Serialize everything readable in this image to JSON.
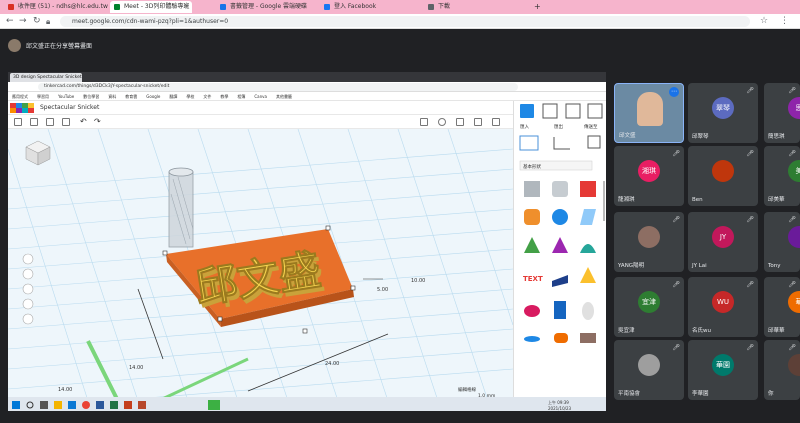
{
  "browser": {
    "tabs": [
      {
        "label": "收件匣 (51) - ndhs@hlc.edu.tw",
        "color": "#d93025",
        "active": false
      },
      {
        "label": "Meet - 3D列印體驗專班",
        "color": "#00832d",
        "active": true
      },
      {
        "label": "書籤管理 - Google 雲端硬碟",
        "color": "#1a73e8",
        "active": false
      },
      {
        "label": "登入 Facebook",
        "color": "#1877f2",
        "active": false
      },
      {
        "label": "下載",
        "color": "#5f6368",
        "active": false
      }
    ],
    "new_tab": "+",
    "url": "meet.google.com/cdn-wami-pzq?pli=1&authuser=0"
  },
  "meet": {
    "presenter_text": "邱文盛正在分享螢幕畫面"
  },
  "shared": {
    "inner_tab_title": "3D design Spectacular Snicket",
    "inner_url": "tinkercad.com/things/d3DCk3jY-spectacular-snicket/edit",
    "bookmarks": [
      "應用程式",
      "學習用",
      "YouTube",
      "數位學習",
      "資料",
      "教育雲",
      "Google",
      "翻譯",
      "學校",
      "文件",
      "教學",
      "相簿",
      "Canva",
      "其他書籤"
    ],
    "design_title": "Spectacular Snicket",
    "model_text": "邱文盛",
    "dims": {
      "w": "24.00",
      "d": "14.00",
      "h": "10.00",
      "h2": "5.00"
    },
    "panel": {
      "tabs": [
        "匯入",
        "匯出",
        "傳送至"
      ],
      "category": "基本形狀"
    },
    "view_label": "編輯格線",
    "snap_label": "貼齊格線",
    "snap_value": "1.0 mm",
    "clock": "上午 09:39",
    "date": "2021/10/23"
  },
  "participants": [
    {
      "name": "邱文盛",
      "initial": "",
      "color": "#6b8aa3",
      "muted": false,
      "camera": true
    },
    {
      "name": "邱翠琴",
      "initial": "翠琴",
      "color": "#5c6bc0",
      "muted": true
    },
    {
      "name": "簡思琪",
      "initial": "思",
      "color": "#8e24aa",
      "muted": true
    },
    {
      "name": "龍湘琪",
      "initial": "湘琪",
      "color": "#e91e63",
      "muted": true
    },
    {
      "name": "Ben",
      "initial": "",
      "color": "#bf360c",
      "muted": true
    },
    {
      "name": "邱美華",
      "initial": "美",
      "color": "#2e7d32",
      "muted": true
    },
    {
      "name": "YANG陽明",
      "initial": "",
      "color": "#8d6e63",
      "muted": true
    },
    {
      "name": "JY Lai",
      "initial": "JY",
      "color": "#c2185b",
      "muted": true
    },
    {
      "name": "Tony",
      "initial": "",
      "color": "#6a1b9a",
      "muted": true
    },
    {
      "name": "吳宜津",
      "initial": "宜津",
      "color": "#2e7d32",
      "muted": true
    },
    {
      "name": "名氏wu",
      "initial": "WU",
      "color": "#c62828",
      "muted": true
    },
    {
      "name": "邱華華",
      "initial": "華",
      "color": "#ef6c00",
      "muted": true
    },
    {
      "name": "平南協會",
      "initial": "",
      "color": "#9e9e9e",
      "muted": true
    },
    {
      "name": "李華園",
      "initial": "華園",
      "color": "#00796b",
      "muted": true
    },
    {
      "name": "你",
      "initial": "",
      "color": "#5d4037",
      "muted": true
    }
  ]
}
